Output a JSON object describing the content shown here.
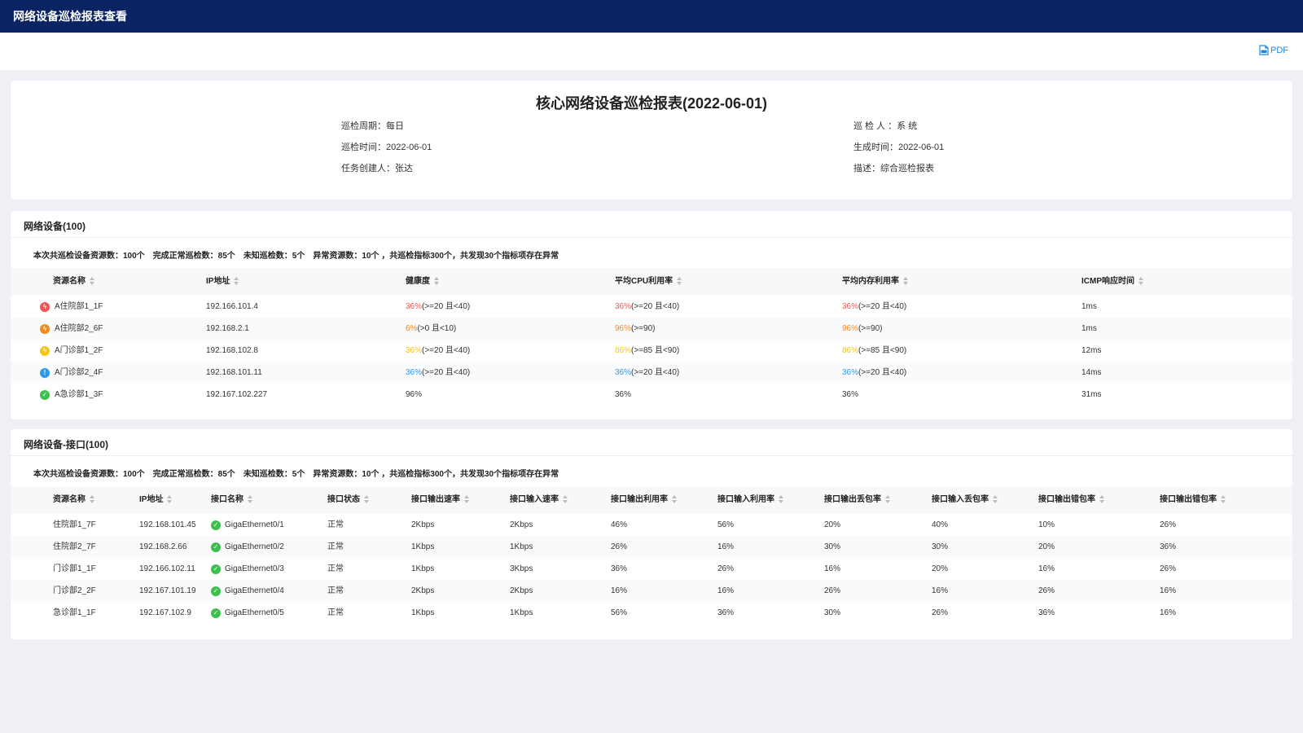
{
  "app_title": "网络设备巡检报表查看",
  "toolbar": {
    "pdf_label": "PDF"
  },
  "report": {
    "title": "核心网络设备巡检报表(2022-06-01)",
    "left_meta": [
      "巡检周期：每日",
      "巡检时间：2022-06-01",
      "任务创建人：张达"
    ],
    "right_meta": [
      "巡 检 人 ：系 统",
      "生成时间：2022-06-01",
      "描述：综合巡检报表"
    ]
  },
  "colors": {
    "critical": "#f05454",
    "major": "#f5891f",
    "minor": "#f5c518",
    "info": "#2f9ae8",
    "normal": "#3fbf4f",
    "header_bg": "#0a2463"
  },
  "network": {
    "title": "网络设备(100)",
    "summary": [
      "本次共巡检设备资源数：100个",
      "完成正常巡检数：85个",
      "未知巡检数：5个",
      "异常资源数：10个 ，共巡检指标300个，共发现30个指标项存在异常"
    ],
    "columns": [
      "资源名称",
      "IP地址",
      "健康度",
      "平均CPU利用率",
      "平均内存利用率",
      "ICMP响应时间"
    ],
    "rows": [
      {
        "icon": "critical",
        "name": "A住院部1_1F",
        "ip": "192.166.101.4",
        "health": {
          "v": "36%",
          "t": "(>=20 且<40)",
          "c": "critical"
        },
        "cpu": {
          "v": "36%",
          "t": "(>=20 且<40)",
          "c": "critical"
        },
        "mem": {
          "v": "36%",
          "t": "(>=20 且<40)",
          "c": "critical"
        },
        "icmp": "1ms"
      },
      {
        "icon": "major",
        "name": "A住院部2_6F",
        "ip": "192.168.2.1",
        "health": {
          "v": "6%",
          "t": "(>0 且<10)",
          "c": "major"
        },
        "cpu": {
          "v": "96%",
          "t": "(>=90)",
          "c": "major"
        },
        "mem": {
          "v": "96%",
          "t": "(>=90)",
          "c": "major"
        },
        "icmp": "1ms"
      },
      {
        "icon": "minor",
        "name": "A门诊部1_2F",
        "ip": "192.168.102.8",
        "health": {
          "v": "36%",
          "t": "(>=20 且<40)",
          "c": "minor"
        },
        "cpu": {
          "v": "86%",
          "t": "(>=85 且<90)",
          "c": "minor"
        },
        "mem": {
          "v": "86%",
          "t": "(>=85 且<90)",
          "c": "minor"
        },
        "icmp": "12ms"
      },
      {
        "icon": "info",
        "name": "A门诊部2_4F",
        "ip": "192.168.101.11",
        "health": {
          "v": "36%",
          "t": "(>=20 且<40)",
          "c": "info"
        },
        "cpu": {
          "v": "36%",
          "t": "(>=20 且<40)",
          "c": "info"
        },
        "mem": {
          "v": "36%",
          "t": "(>=20 且<40)",
          "c": "info"
        },
        "icmp": "14ms"
      },
      {
        "icon": "normal",
        "name": "A急诊部1_3F",
        "ip": "192.167.102.227",
        "health": {
          "v": "96%",
          "t": "",
          "c": ""
        },
        "cpu": {
          "v": "36%",
          "t": "",
          "c": ""
        },
        "mem": {
          "v": "36%",
          "t": "",
          "c": ""
        },
        "icmp": "31ms"
      }
    ]
  },
  "interfaces": {
    "title": "网络设备-接口(100)",
    "summary": [
      "本次共巡检设备资源数：100个",
      "完成正常巡检数：85个",
      "未知巡检数：5个",
      "异常资源数：10个 ，共巡检指标300个，共发现30个指标项存在异常"
    ],
    "columns": [
      "资源名称",
      "IP地址",
      "接口名称",
      "接口状态",
      "接口输出速率",
      "接口输入速率",
      "接口输出利用率",
      "接口输入利用率",
      "接口输出丢包率",
      "接口输入丢包率",
      "接口输出错包率",
      "接口输出错包率"
    ],
    "rows": [
      [
        "住院部1_7F",
        "192.168.101.45",
        "GigaEthernet0/1",
        "正常",
        "2Kbps",
        "2Kbps",
        "46%",
        "56%",
        "20%",
        "40%",
        "10%",
        "26%"
      ],
      [
        "住院部2_7F",
        "192.168.2.66",
        "GigaEthernet0/2",
        "正常",
        "1Kbps",
        "1Kbps",
        "26%",
        "16%",
        "30%",
        "30%",
        "20%",
        "36%"
      ],
      [
        "门诊部1_1F",
        "192.166.102.11",
        "GigaEthernet0/3",
        "正常",
        "1Kbps",
        "3Kbps",
        "36%",
        "26%",
        "16%",
        "20%",
        "16%",
        "26%"
      ],
      [
        "门诊部2_2F",
        "192.167.101.19",
        "GigaEthernet0/4",
        "正常",
        "2Kbps",
        "2Kbps",
        "16%",
        "16%",
        "26%",
        "16%",
        "26%",
        "16%"
      ],
      [
        "急诊部1_1F",
        "192.167.102.9",
        "GigaEthernet0/5",
        "正常",
        "1Kbps",
        "1Kbps",
        "56%",
        "36%",
        "30%",
        "26%",
        "36%",
        "16%"
      ]
    ]
  }
}
